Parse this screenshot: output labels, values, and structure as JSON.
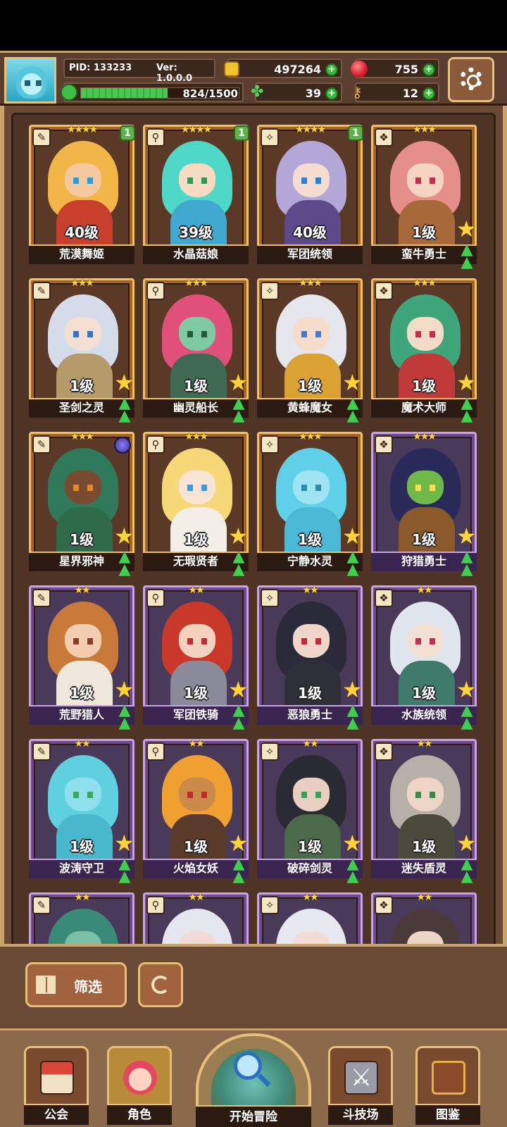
{
  "header": {
    "pid": "PID: 133233",
    "version": "Ver: 1.0.0.0",
    "gold": "497264",
    "gems": "755",
    "clover": "39",
    "keys": "12",
    "energy_text": "824/1500",
    "energy_fraction": 0.549
  },
  "cards": [
    {
      "name": "荒漠舞姬",
      "level": "40级",
      "stars": "★★★★",
      "rarity": "gold",
      "badge": "1",
      "hair": "#f2b648",
      "skin": "#f5c9a0",
      "eye": "#2c9cd6",
      "body": "#c8402c"
    },
    {
      "name": "水晶菇娘",
      "level": "39级",
      "stars": "★★★★",
      "rarity": "gold",
      "badge": "1",
      "hair": "#4fd8c8",
      "skin": "#f7dcc3",
      "eye": "#2e9a54",
      "body": "#3fa9d0"
    },
    {
      "name": "军团统领",
      "level": "40级",
      "stars": "★★★★",
      "rarity": "gold",
      "badge": "1",
      "hair": "#b5a6d8",
      "skin": "#f3dcd0",
      "eye": "#2f7fd2",
      "body": "#5e4a8a"
    },
    {
      "name": "蛮牛勇士",
      "level": "1级",
      "stars": "★★★",
      "rarity": "gold",
      "badge": "",
      "hair": "#e68f8a",
      "skin": "#f6d4c2",
      "eye": "#c0304a",
      "body": "#a86a3a"
    },
    {
      "name": "圣剑之灵",
      "level": "1级",
      "stars": "★★★",
      "rarity": "gold",
      "badge": "",
      "hair": "#d4dcea",
      "skin": "#f3e0d2",
      "eye": "#3a73c4",
      "body": "#b59a6a"
    },
    {
      "name": "幽灵船长",
      "level": "1级",
      "stars": "★★★",
      "rarity": "gold",
      "badge": "",
      "hair": "#e0507a",
      "skin": "#7fc9a3",
      "eye": "#1f5a3a",
      "body": "#3f6a52"
    },
    {
      "name": "黄蜂魔女",
      "level": "1级",
      "stars": "★★★",
      "rarity": "gold",
      "badge": "",
      "hair": "#e6e6ee",
      "skin": "#f5dccb",
      "eye": "#4a7ac4",
      "body": "#d9a233"
    },
    {
      "name": "魔术大师",
      "level": "1级",
      "stars": "★★★",
      "rarity": "gold",
      "badge": "",
      "hair": "#3fa57a",
      "skin": "#f3dcc8",
      "eye": "#c03048",
      "body": "#c03a3a"
    },
    {
      "name": "星界邪神",
      "level": "1级",
      "stars": "★★★",
      "rarity": "gold",
      "badge": "",
      "hair": "#2f7a5a",
      "skin": "#7a4a32",
      "eye": "#e08a2a",
      "body": "#2f6a4a"
    },
    {
      "name": "无瑕贤者",
      "level": "1级",
      "stars": "★★★",
      "rarity": "gold",
      "badge": "",
      "hair": "#f6d878",
      "skin": "#f8e4d4",
      "eye": "#3f9ad8",
      "body": "#f4efe6"
    },
    {
      "name": "宁静水灵",
      "level": "1级",
      "stars": "★★★",
      "rarity": "gold",
      "badge": "",
      "hair": "#5fd0e8",
      "skin": "#9fe4f2",
      "eye": "#2d8aa8",
      "body": "#4bb8d6"
    },
    {
      "name": "狩猎勇士",
      "level": "1级",
      "stars": "★★★",
      "rarity": "purple",
      "badge": "",
      "hair": "#2a2a5a",
      "skin": "#6fb84a",
      "eye": "#ffdd55",
      "body": "#8a5a2a"
    },
    {
      "name": "荒野猎人",
      "level": "1级",
      "stars": "★★",
      "rarity": "purple",
      "badge": "",
      "hair": "#c97a3a",
      "skin": "#f2cdb0",
      "eye": "#8a3a2a",
      "body": "#efe6dc"
    },
    {
      "name": "军团铁骑",
      "level": "1级",
      "stars": "★★",
      "rarity": "purple",
      "badge": "",
      "hair": "#c8392a",
      "skin": "#f3d3bf",
      "eye": "#c02a3a",
      "body": "#8a8a9a"
    },
    {
      "name": "恶狼勇士",
      "level": "1级",
      "stars": "★★",
      "rarity": "purple",
      "badge": "",
      "hair": "#2a2a3a",
      "skin": "#f0d6c8",
      "eye": "#c02a3a",
      "body": "#2f2f3a"
    },
    {
      "name": "水族统领",
      "level": "1级",
      "stars": "★★",
      "rarity": "purple",
      "badge": "",
      "hair": "#dfe6ee",
      "skin": "#f3e0d4",
      "eye": "#c03050",
      "body": "#3f7a6a"
    },
    {
      "name": "波涛守卫",
      "level": "1级",
      "stars": "★★",
      "rarity": "purple",
      "badge": "",
      "hair": "#5fd0e0",
      "skin": "#8fe0ee",
      "eye": "#3aa85a",
      "body": "#4ab8cc"
    },
    {
      "name": "火焰女妖",
      "level": "1级",
      "stars": "★★",
      "rarity": "purple",
      "badge": "",
      "hair": "#f0a030",
      "skin": "#c98a4a",
      "eye": "#c02a2a",
      "body": "#5a3a2a"
    },
    {
      "name": "破碎剑灵",
      "level": "1级",
      "stars": "★★",
      "rarity": "purple",
      "badge": "",
      "hair": "#2a2a32",
      "skin": "#e8cfc2",
      "eye": "#3aa05a",
      "body": "#4a6a4a"
    },
    {
      "name": "迷失盾灵",
      "level": "1级",
      "stars": "★★",
      "rarity": "purple",
      "badge": "",
      "hair": "#b8b0a8",
      "skin": "#eed6c6",
      "eye": "#3a8a4a",
      "body": "#4a4a3a"
    },
    {
      "name": "",
      "level": "",
      "stars": "★★",
      "rarity": "purple",
      "badge": "",
      "hair": "#3a8a7a",
      "skin": "#7ac0a8",
      "eye": "#3a3a3a",
      "body": "#3a6a5a"
    },
    {
      "name": "",
      "level": "",
      "stars": "★★",
      "rarity": "purple",
      "badge": "",
      "hair": "#e6e6ee",
      "skin": "#f0dcd4",
      "eye": "#c03050",
      "body": "#8a7a8a"
    },
    {
      "name": "",
      "level": "",
      "stars": "★★",
      "rarity": "purple",
      "badge": "",
      "hair": "#e8e8f0",
      "skin": "#f2dcd4",
      "eye": "#c03050",
      "body": "#5a6a8a"
    },
    {
      "name": "",
      "level": "",
      "stars": "★★",
      "rarity": "purple",
      "badge": "",
      "hair": "#4a3a3a",
      "skin": "#eed6c6",
      "eye": "#c03050",
      "body": "#4a3a3a"
    }
  ],
  "filter": {
    "label": "筛选"
  },
  "nav": {
    "guild": "公会",
    "character": "角色",
    "adventure": "开始冒险",
    "arena": "斗技场",
    "codex": "图鉴"
  }
}
